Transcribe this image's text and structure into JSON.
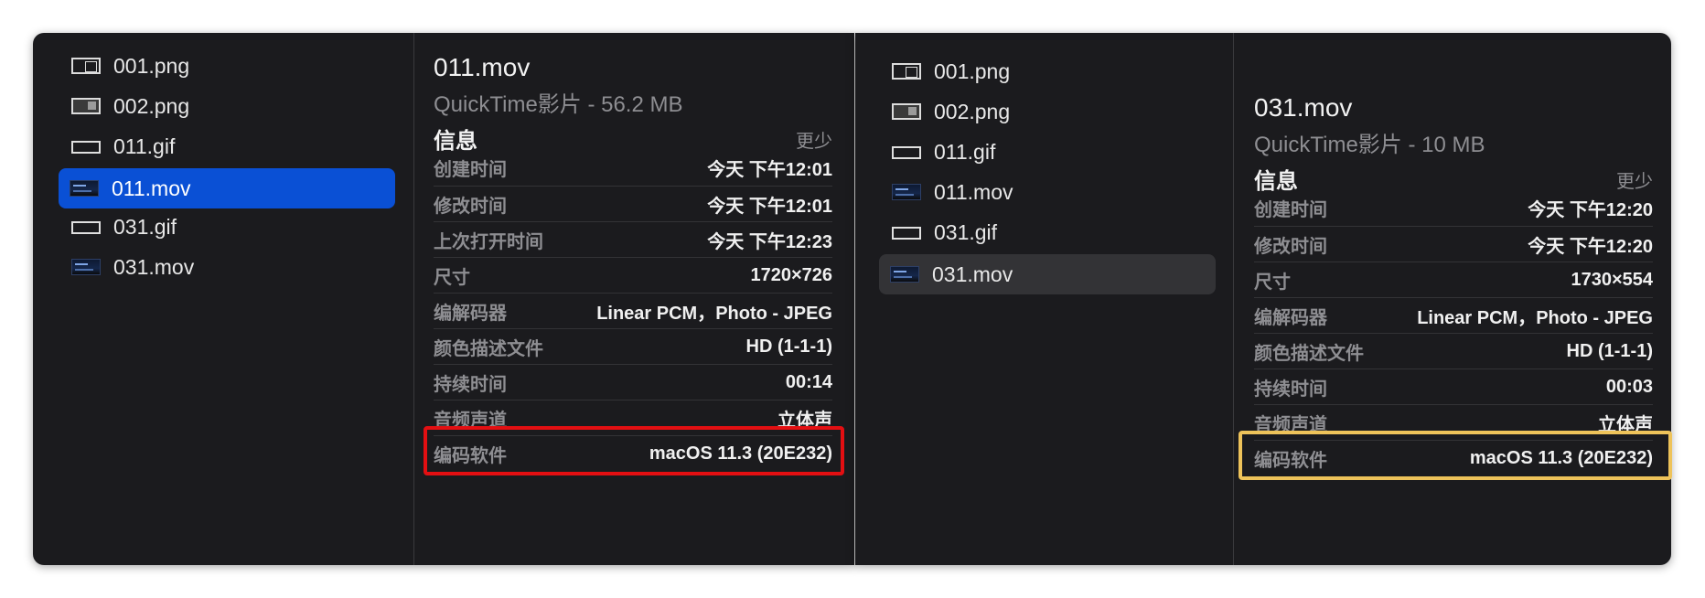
{
  "left_window": {
    "files": [
      {
        "name": "001.png",
        "icon": "png-image-icon"
      },
      {
        "name": "002.png",
        "icon": "png-image-icon"
      },
      {
        "name": "011.gif",
        "icon": "gif-image-icon"
      },
      {
        "name": "011.mov",
        "icon": "movie-file-icon",
        "selected": true
      },
      {
        "name": "031.gif",
        "icon": "gif-image-icon"
      },
      {
        "name": "031.mov",
        "icon": "movie-file-icon"
      }
    ],
    "preview": {
      "title": "011.mov",
      "subtitle": "QuickTime影片 - 56.2 MB",
      "section_title": "信息",
      "section_toggle": "更少",
      "rows": [
        {
          "label": "创建时间",
          "value": "今天 下午12:01"
        },
        {
          "label": "修改时间",
          "value": "今天 下午12:01"
        },
        {
          "label": "上次打开时间",
          "value": "今天 下午12:23"
        },
        {
          "label": "尺寸",
          "value": "1720×726"
        },
        {
          "label": "编解码器",
          "value": "Linear PCM，Photo - JPEG"
        },
        {
          "label": "颜色描述文件",
          "value": "HD (1-1-1)"
        },
        {
          "label": "持续时间",
          "value": "00:14"
        },
        {
          "label": "音频声道",
          "value": "立体声"
        },
        {
          "label": "编码软件",
          "value": "macOS 11.3 (20E232)"
        }
      ]
    }
  },
  "right_window": {
    "files": [
      {
        "name": "001.png",
        "icon": "png-image-icon"
      },
      {
        "name": "002.png",
        "icon": "png-image-icon"
      },
      {
        "name": "011.gif",
        "icon": "gif-image-icon"
      },
      {
        "name": "011.mov",
        "icon": "movie-file-icon"
      },
      {
        "name": "031.gif",
        "icon": "gif-image-icon"
      },
      {
        "name": "031.mov",
        "icon": "movie-file-icon",
        "selected": true
      }
    ],
    "preview": {
      "title": "031.mov",
      "subtitle": "QuickTime影片 - 10 MB",
      "section_title": "信息",
      "section_toggle": "更少",
      "rows": [
        {
          "label": "创建时间",
          "value": "今天 下午12:20"
        },
        {
          "label": "修改时间",
          "value": "今天 下午12:20"
        },
        {
          "label": "尺寸",
          "value": "1730×554"
        },
        {
          "label": "编解码器",
          "value": "Linear PCM，Photo - JPEG"
        },
        {
          "label": "颜色描述文件",
          "value": "HD (1-1-1)"
        },
        {
          "label": "持续时间",
          "value": "00:03"
        },
        {
          "label": "音频声道",
          "value": "立体声"
        },
        {
          "label": "编码软件",
          "value": "macOS 11.3 (20E232)"
        }
      ]
    }
  },
  "colors": {
    "selection_blue": "#0a50d5",
    "highlight_red": "#e30f12",
    "highlight_yellow": "#eec35a"
  }
}
